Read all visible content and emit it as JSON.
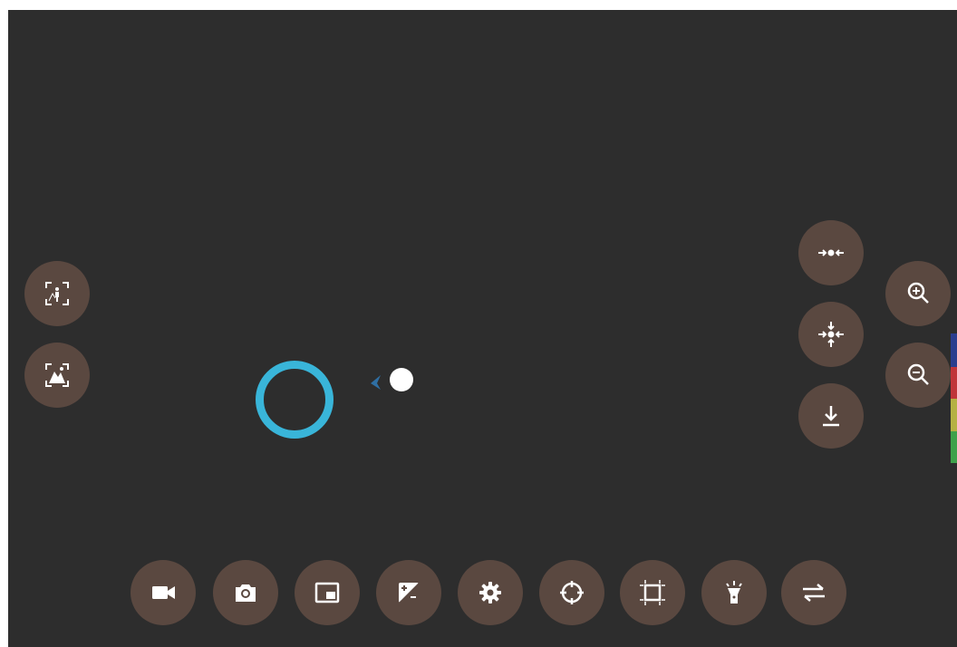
{
  "screen": {
    "background": "#2d2d2d",
    "button_color": "#5a4840",
    "focus_ring_color": "#39b5d9"
  },
  "left_controls": [
    {
      "icon": "portrait-mode-icon"
    },
    {
      "icon": "landscape-mode-icon"
    }
  ],
  "right_controls": [
    {
      "icon": "focus-center-icon"
    },
    {
      "icon": "focus-all-icon"
    },
    {
      "icon": "download-icon"
    }
  ],
  "zoom_controls": [
    {
      "icon": "zoom-in-icon"
    },
    {
      "icon": "zoom-out-icon"
    }
  ],
  "bottom_toolbar": [
    {
      "icon": "video-camera-icon"
    },
    {
      "icon": "camera-icon"
    },
    {
      "icon": "picture-in-picture-icon"
    },
    {
      "icon": "exposure-icon"
    },
    {
      "icon": "settings-gear-icon"
    },
    {
      "icon": "crosshair-icon"
    },
    {
      "icon": "crop-frame-icon"
    },
    {
      "icon": "flashlight-icon"
    },
    {
      "icon": "swap-arrows-icon"
    }
  ],
  "color_strip": [
    "#2b3d8f",
    "#c0353a",
    "#b5b143",
    "#3fa14b"
  ]
}
